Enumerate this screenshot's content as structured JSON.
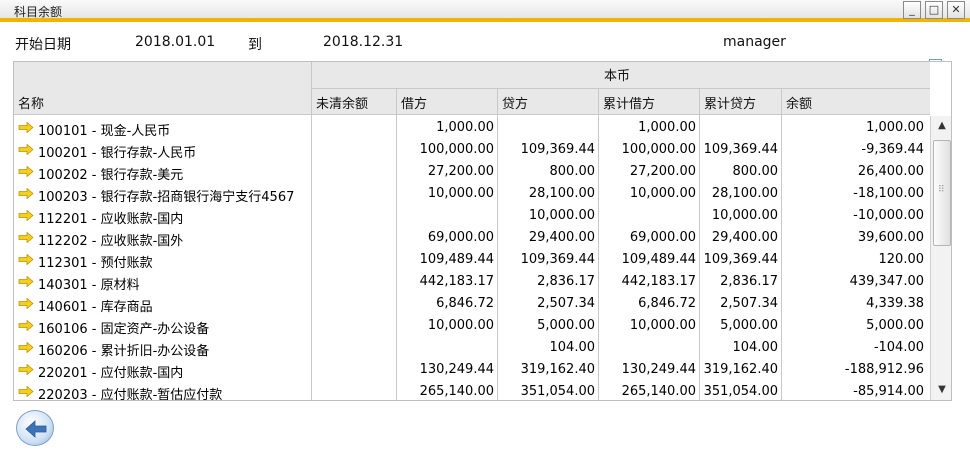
{
  "window": {
    "title": "科目余额",
    "min_glyph": "_",
    "max_glyph": "□",
    "close_glyph": "✕"
  },
  "header": {
    "start_label": "开始日期",
    "start_value": "2018.01.01",
    "to_label": "到",
    "end_value": "2018.12.31",
    "user": "manager"
  },
  "table": {
    "group_header": "本币",
    "columns": [
      "名称",
      "未清余额",
      "借方",
      "贷方",
      "累计借方",
      "累计贷方",
      "余额"
    ],
    "rows": [
      {
        "name": "100101 - 现金-人民币",
        "open": "",
        "debit": "1,000.00",
        "credit": "",
        "cum_debit": "1,000.00",
        "cum_credit": "",
        "balance": "1,000.00"
      },
      {
        "name": "100201 - 银行存款-人民币",
        "open": "",
        "debit": "100,000.00",
        "credit": "109,369.44",
        "cum_debit": "100,000.00",
        "cum_credit": "109,369.44",
        "balance": "-9,369.44"
      },
      {
        "name": "100202 - 银行存款-美元",
        "open": "",
        "debit": "27,200.00",
        "credit": "800.00",
        "cum_debit": "27,200.00",
        "cum_credit": "800.00",
        "balance": "26,400.00"
      },
      {
        "name": "100203 - 银行存款-招商银行海宁支行4567",
        "open": "",
        "debit": "10,000.00",
        "credit": "28,100.00",
        "cum_debit": "10,000.00",
        "cum_credit": "28,100.00",
        "balance": "-18,100.00"
      },
      {
        "name": "112201 - 应收账款-国内",
        "open": "",
        "debit": "",
        "credit": "10,000.00",
        "cum_debit": "",
        "cum_credit": "10,000.00",
        "balance": "-10,000.00"
      },
      {
        "name": "112202 - 应收账款-国外",
        "open": "",
        "debit": "69,000.00",
        "credit": "29,400.00",
        "cum_debit": "69,000.00",
        "cum_credit": "29,400.00",
        "balance": "39,600.00"
      },
      {
        "name": "112301 - 预付账款",
        "open": "",
        "debit": "109,489.44",
        "credit": "109,369.44",
        "cum_debit": "109,489.44",
        "cum_credit": "109,369.44",
        "balance": "120.00"
      },
      {
        "name": "140301 - 原材料",
        "open": "",
        "debit": "442,183.17",
        "credit": "2,836.17",
        "cum_debit": "442,183.17",
        "cum_credit": "2,836.17",
        "balance": "439,347.00"
      },
      {
        "name": "140601 - 库存商品",
        "open": "",
        "debit": "6,846.72",
        "credit": "2,507.34",
        "cum_debit": "6,846.72",
        "cum_credit": "2,507.34",
        "balance": "4,339.38"
      },
      {
        "name": "160106 - 固定资产-办公设备",
        "open": "",
        "debit": "10,000.00",
        "credit": "5,000.00",
        "cum_debit": "10,000.00",
        "cum_credit": "5,000.00",
        "balance": "5,000.00"
      },
      {
        "name": "160206 - 累计折旧-办公设备",
        "open": "",
        "debit": "",
        "credit": "104.00",
        "cum_debit": "",
        "cum_credit": "104.00",
        "balance": "-104.00"
      },
      {
        "name": "220201 - 应付账款-国内",
        "open": "",
        "debit": "130,249.44",
        "credit": "319,162.40",
        "cum_debit": "130,249.44",
        "cum_credit": "319,162.40",
        "balance": "-188,912.96"
      },
      {
        "name": "220203 - 应付账款-暂估应付款",
        "open": "",
        "debit": "265,140.00",
        "credit": "351,054.00",
        "cum_debit": "265,140.00",
        "cum_credit": "351,054.00",
        "balance": "-85,914.00"
      }
    ]
  },
  "scroll": {
    "up_glyph": "▲",
    "down_glyph": "▼",
    "grip_glyph": "⠿"
  },
  "icons": {
    "row_icon": "yellow-right-arrow-icon",
    "back_icon": "back-arrow-icon",
    "expand_icon": "expand-arrow-icon"
  },
  "colors": {
    "title_accent": "#f2b400",
    "header_band": "#e8e8e8",
    "row_arrow": "#f5cf1e"
  }
}
